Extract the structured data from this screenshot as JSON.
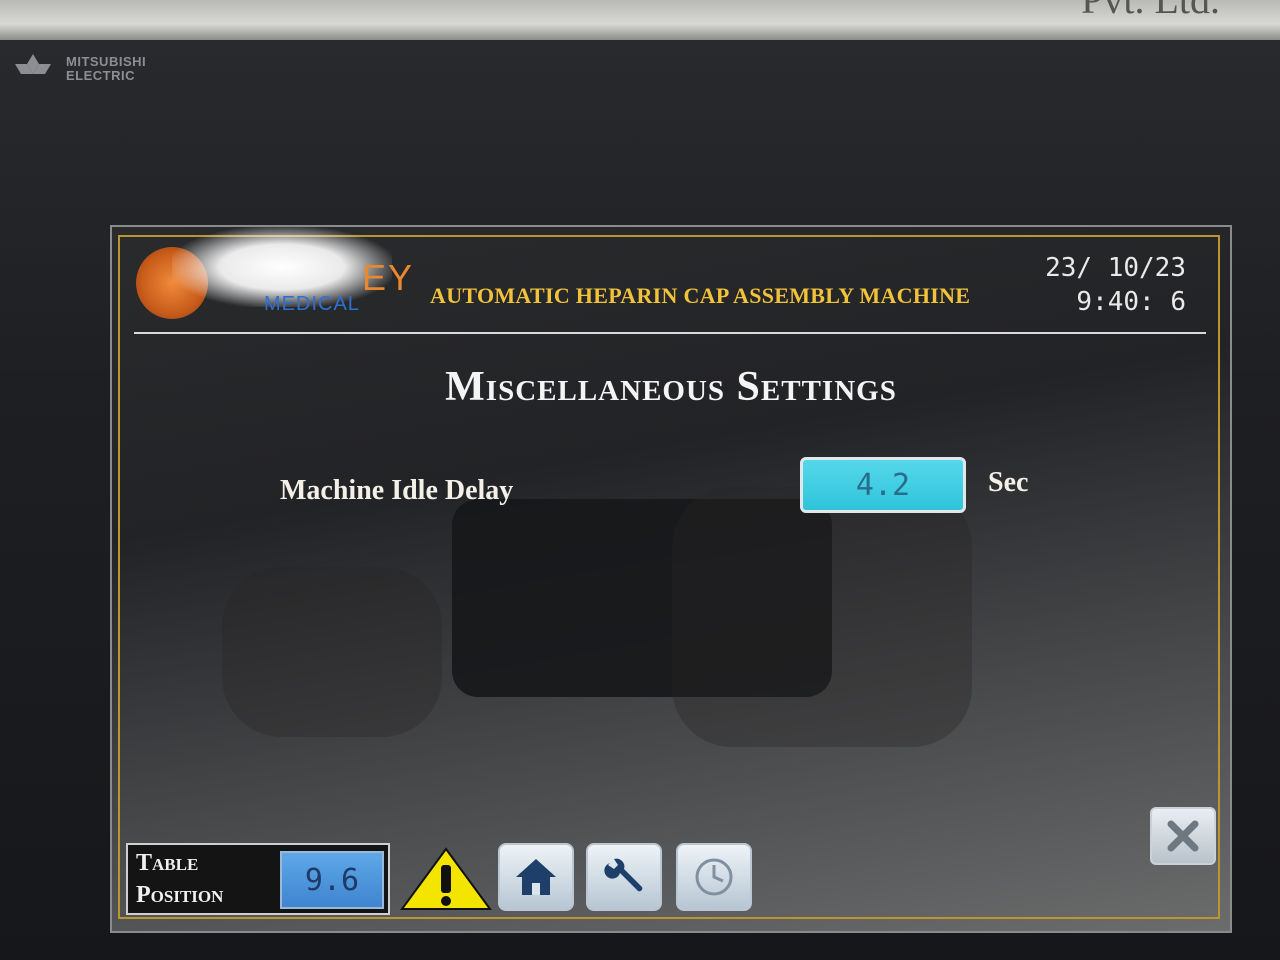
{
  "wall": {
    "text": "Pvt. Ltd."
  },
  "device": {
    "brand": "MITSUBISHI\nELECTRIC"
  },
  "header": {
    "logo_text": "EY",
    "logo_sub": "MEDICAL",
    "title": "AUTOMATIC HEPARIN CAP ASSEMBLY MACHINE",
    "date": "23/ 10/23",
    "time": "9:40: 6"
  },
  "page": {
    "title": "Miscellaneous Settings"
  },
  "settings": {
    "machine_idle_delay": {
      "label": "Machine Idle Delay",
      "value": "4.2",
      "unit": "Sec"
    }
  },
  "footer": {
    "table_position": {
      "label": "Table\nPosition",
      "value": "9.6"
    },
    "buttons": [
      "warning-icon",
      "home-icon",
      "wrench-icon",
      "clock-icon"
    ]
  },
  "colors": {
    "accent_gold": "#b9962f",
    "title_yellow": "#f2c23a",
    "field_cyan": "#2fc4dc",
    "field_blue": "#3f84d0",
    "warning_yellow": "#f4e500"
  }
}
